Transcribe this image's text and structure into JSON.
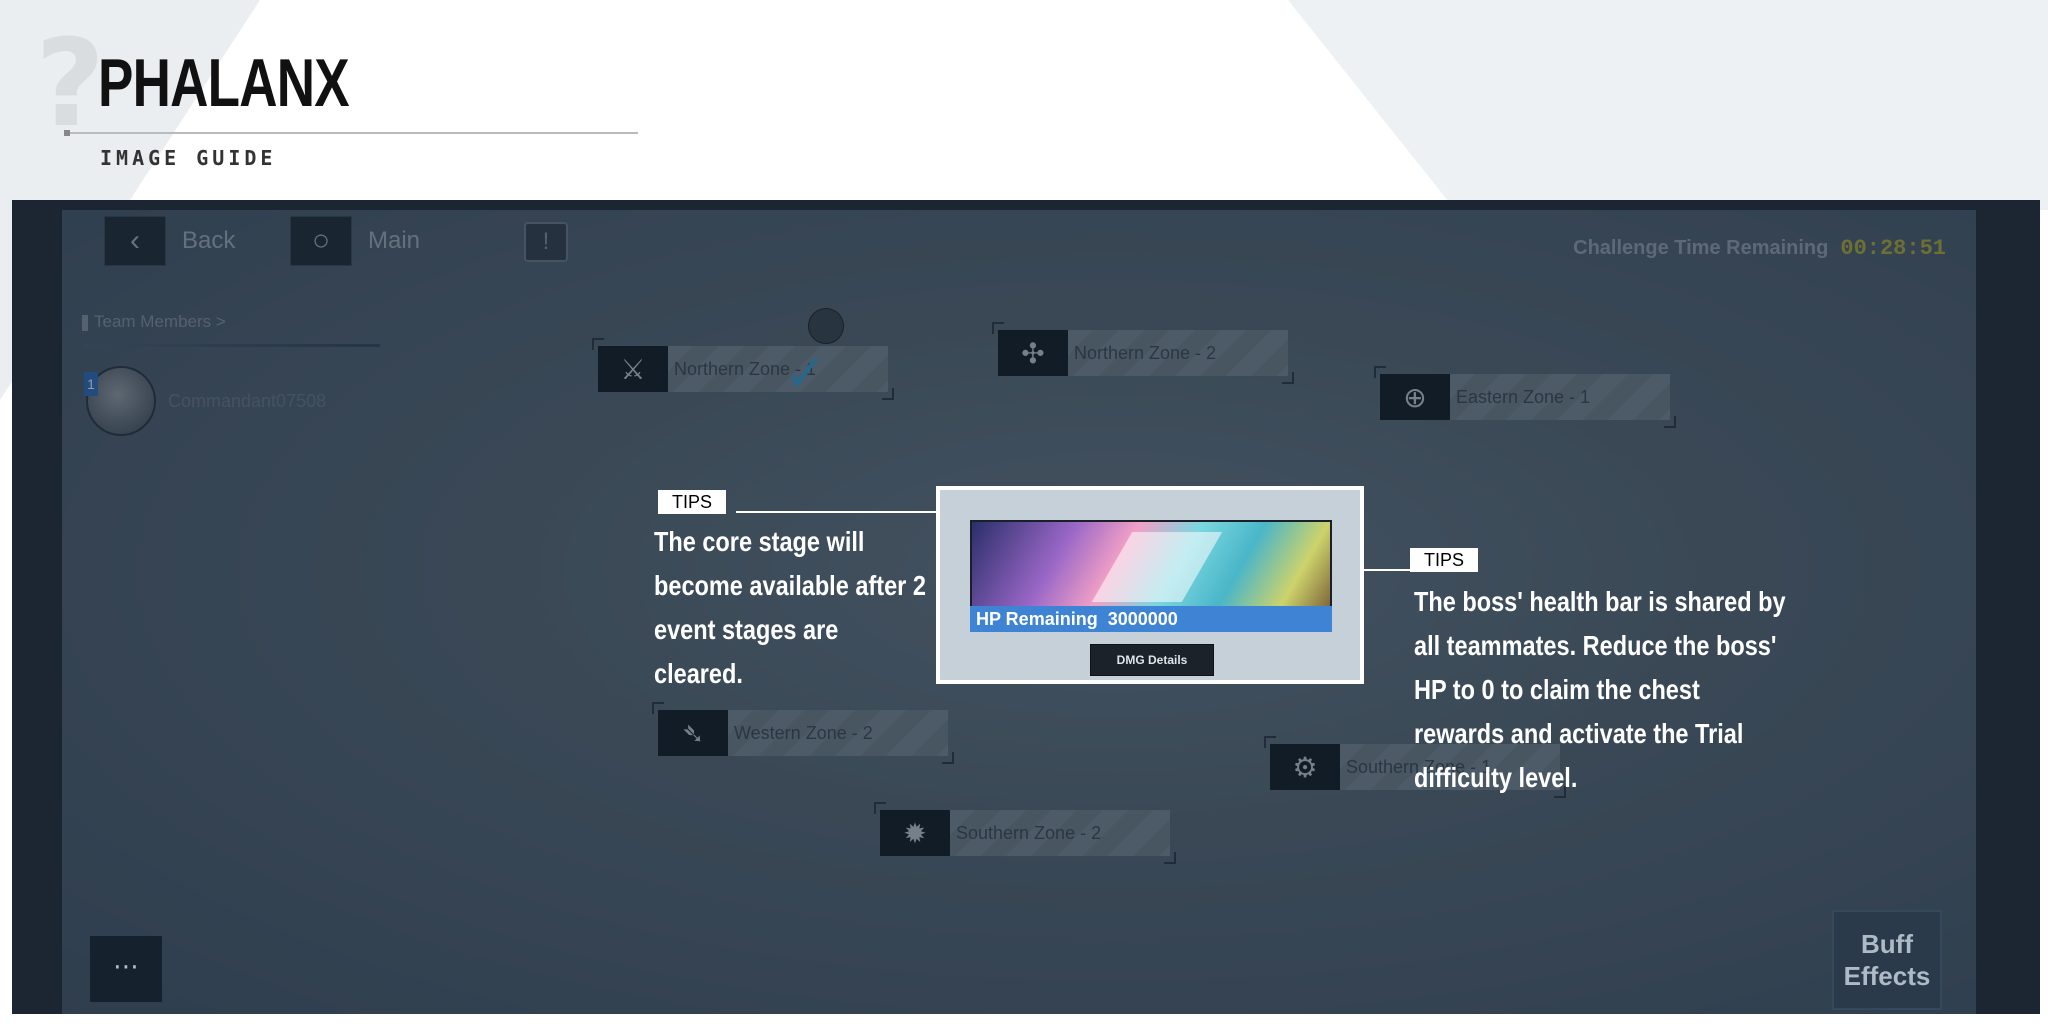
{
  "brand": {
    "title": "PHALANX",
    "subtitle": "IMAGE GUIDE"
  },
  "screen": {
    "back_label": "Back",
    "main_label": "Main",
    "info_symbol": "!",
    "timer_label": "Challenge Time Remaining",
    "timer_value": "00:28:51",
    "team_header": "Team Members >",
    "member_name": "Commandant07508",
    "member_level": "1",
    "zones": [
      {
        "label": "Northern Zone - 1",
        "icon": "axe-icon"
      },
      {
        "label": "Northern Zone - 2",
        "icon": "arrow-compass-icon"
      },
      {
        "label": "Eastern Zone - 1",
        "icon": "cross-circle-icon"
      },
      {
        "label": "Western Zone - 2",
        "icon": "runner-icon"
      },
      {
        "label": "Southern Zone - 1",
        "icon": "gear-target-icon"
      },
      {
        "label": "Southern Zone - 2",
        "icon": "splash-icon"
      }
    ],
    "buff_label": "Buff Effects",
    "chat_icon": "chat-bubble-icon"
  },
  "boss": {
    "hp_label": "HP Remaining",
    "hp_value": "3000000",
    "dmg_button": "DMG Details"
  },
  "tips": [
    {
      "tag": "TIPS",
      "text": "The core stage will become available after 2 event stages are cleared."
    },
    {
      "tag": "TIPS",
      "text": "The boss' health bar is shared by all teammates. Reduce the boss' HP to 0 to claim the chest rewards and activate the Trial difficulty level."
    }
  ]
}
